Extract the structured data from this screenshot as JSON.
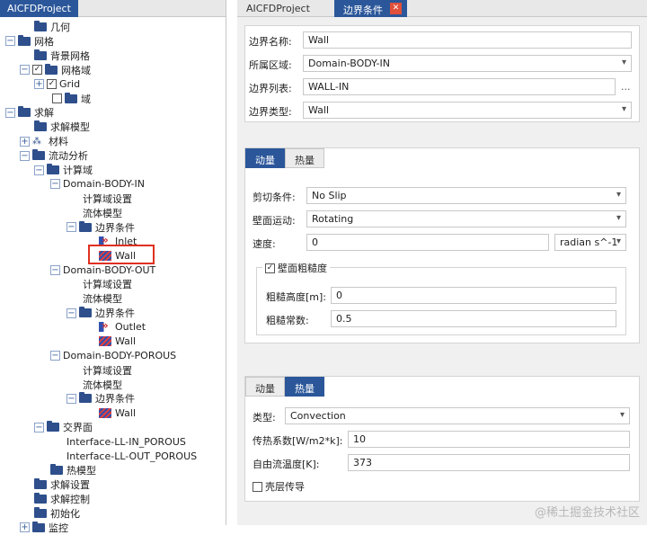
{
  "left_panel": {
    "tab_title": "AICFDProject"
  },
  "tree": [
    {
      "label": "几何",
      "icon": "folder-icon",
      "exp": "",
      "chk": ""
    },
    {
      "label": "网格",
      "icon": "folder-icon",
      "exp": "−",
      "chk": ""
    },
    {
      "label": "背景网格",
      "icon": "folder-icon",
      "exp": "",
      "chk": ""
    },
    {
      "label": "网格域",
      "icon": "folder-icon",
      "exp": "−",
      "chk": "✓"
    },
    {
      "label": "Grid",
      "icon": "",
      "exp": "+",
      "chk": "✓"
    },
    {
      "label": "域",
      "icon": "folder-icon",
      "exp": "",
      "chk": " "
    },
    {
      "label": "求解",
      "icon": "folder-icon",
      "exp": "−",
      "chk": ""
    },
    {
      "label": "求解模型",
      "icon": "folder-icon",
      "exp": "",
      "chk": ""
    },
    {
      "label": "材料",
      "icon": "material-icon",
      "exp": "+",
      "chk": ""
    },
    {
      "label": "流动分析",
      "icon": "folder-icon",
      "exp": "−",
      "chk": ""
    },
    {
      "label": "计算域",
      "icon": "folder-icon",
      "exp": "−",
      "chk": ""
    },
    {
      "label": "Domain-BODY-IN",
      "icon": "",
      "exp": "−",
      "chk": ""
    },
    {
      "label": "计算域设置",
      "icon": "",
      "exp": "",
      "chk": ""
    },
    {
      "label": "流体模型",
      "icon": "",
      "exp": "",
      "chk": ""
    },
    {
      "label": "边界条件",
      "icon": "folder-icon",
      "exp": "−",
      "chk": ""
    },
    {
      "label": "Inlet",
      "icon": "inlet-icon",
      "exp": "",
      "chk": ""
    },
    {
      "label": "Wall",
      "icon": "wall-icon",
      "exp": "",
      "chk": ""
    },
    {
      "label": "Domain-BODY-OUT",
      "icon": "",
      "exp": "−",
      "chk": ""
    },
    {
      "label": "计算域设置",
      "icon": "",
      "exp": "",
      "chk": ""
    },
    {
      "label": "流体模型",
      "icon": "",
      "exp": "",
      "chk": ""
    },
    {
      "label": "边界条件",
      "icon": "folder-icon",
      "exp": "−",
      "chk": ""
    },
    {
      "label": "Outlet",
      "icon": "outlet-icon",
      "exp": "",
      "chk": ""
    },
    {
      "label": "Wall",
      "icon": "wall-icon",
      "exp": "",
      "chk": ""
    },
    {
      "label": "Domain-BODY-POROUS",
      "icon": "",
      "exp": "−",
      "chk": ""
    },
    {
      "label": "计算域设置",
      "icon": "",
      "exp": "",
      "chk": ""
    },
    {
      "label": "流体模型",
      "icon": "",
      "exp": "",
      "chk": ""
    },
    {
      "label": "边界条件",
      "icon": "folder-icon",
      "exp": "−",
      "chk": ""
    },
    {
      "label": "Wall",
      "icon": "wall-icon",
      "exp": "",
      "chk": ""
    },
    {
      "label": "交界面",
      "icon": "folder-icon",
      "exp": "−",
      "chk": ""
    },
    {
      "label": "Interface-LL-IN_POROUS",
      "icon": "",
      "exp": "",
      "chk": ""
    },
    {
      "label": "Interface-LL-OUT_POROUS",
      "icon": "",
      "exp": "",
      "chk": ""
    },
    {
      "label": "热模型",
      "icon": "folder-icon",
      "exp": "",
      "chk": ""
    },
    {
      "label": "求解设置",
      "icon": "folder-icon",
      "exp": "",
      "chk": ""
    },
    {
      "label": "求解控制",
      "icon": "folder-icon",
      "exp": "",
      "chk": ""
    },
    {
      "label": "初始化",
      "icon": "folder-icon",
      "exp": "",
      "chk": ""
    },
    {
      "label": "监控",
      "icon": "folder-icon",
      "exp": "+",
      "chk": ""
    }
  ],
  "right_panel": {
    "tab_project": "AICFDProject",
    "tab_active": "边界条件",
    "close_glyph": "✕",
    "boundary": {
      "name_label": "边界名称:",
      "name_value": "Wall",
      "region_label": "所属区域:",
      "region_value": "Domain-BODY-IN",
      "list_label": "边界列表:",
      "list_value": "WALL-IN",
      "list_button": "...",
      "type_label": "边界类型:",
      "type_value": "Wall"
    },
    "momentum_panel": {
      "tab_momentum": "动量",
      "tab_heat": "热量",
      "shear_label": "剪切条件:",
      "shear_value": "No Slip",
      "motion_label": "壁面运动:",
      "motion_value": "Rotating",
      "speed_label": "速度:",
      "speed_value": "0",
      "speed_unit": "radian s^-1",
      "roughness_checkbox": "壁面粗糙度",
      "roughness_checked": "✓",
      "rough_height_label": "粗糙高度[m]:",
      "rough_height_value": "0",
      "rough_const_label": "粗糙常数:",
      "rough_const_value": "0.5"
    },
    "heat_panel": {
      "tab_momentum": "动量",
      "tab_heat": "热量",
      "type_label": "类型:",
      "type_value": "Convection",
      "coef_label": "传热系数[W/m2*k]:",
      "coef_value": "10",
      "temp_label": "自由流温度[K]:",
      "temp_value": "373",
      "shell_label": "壳层传导",
      "shell_checked": ""
    }
  },
  "watermark": "@稀土掘金技术社区"
}
